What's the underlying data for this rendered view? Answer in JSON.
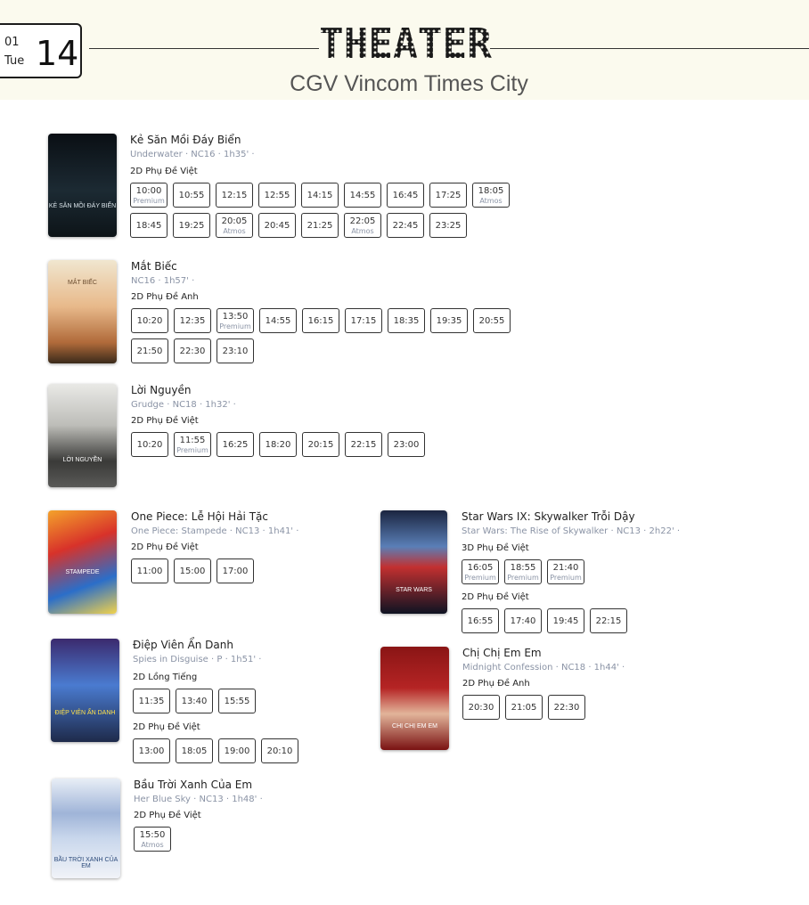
{
  "date": {
    "month": "01",
    "weekday": "Tue",
    "day": "14"
  },
  "header": {
    "title": "THEATER",
    "cinema": "CGV Vincom Times City"
  },
  "movies": [
    {
      "title": "Kẻ Săn Mồi Đáy Biển",
      "meta": "Underwater · NC16 · 1h35' ·",
      "formats": [
        {
          "label": "2D Phụ Đề Việt",
          "showtimes": [
            {
              "time": "10:00",
              "tag": "Premium"
            },
            {
              "time": "10:55"
            },
            {
              "time": "12:15"
            },
            {
              "time": "12:55"
            },
            {
              "time": "14:15"
            },
            {
              "time": "14:55"
            },
            {
              "time": "16:45"
            },
            {
              "time": "17:25"
            },
            {
              "time": "18:05",
              "tag": "Atmos"
            },
            {
              "time": "18:45"
            },
            {
              "time": "19:25"
            },
            {
              "time": "20:05",
              "tag": "Atmos"
            },
            {
              "time": "20:45"
            },
            {
              "time": "21:25"
            },
            {
              "time": "22:05",
              "tag": "Atmos"
            },
            {
              "time": "22:45"
            },
            {
              "time": "23:25"
            }
          ]
        }
      ],
      "poster_text": "KẺ SĂN MỒI ĐÁY BIỂN"
    },
    {
      "title": "Mắt Biếc",
      "meta": "NC16 · 1h57' ·",
      "formats": [
        {
          "label": "2D Phụ Đề Anh",
          "showtimes": [
            {
              "time": "10:20"
            },
            {
              "time": "12:35"
            },
            {
              "time": "13:50",
              "tag": "Premium"
            },
            {
              "time": "14:55"
            },
            {
              "time": "16:15"
            },
            {
              "time": "17:15"
            },
            {
              "time": "18:35"
            },
            {
              "time": "19:35"
            },
            {
              "time": "20:55"
            },
            {
              "time": "21:50"
            },
            {
              "time": "22:30"
            },
            {
              "time": "23:10"
            }
          ]
        }
      ],
      "poster_text": "MẮT BIẾC"
    },
    {
      "title": "Lời Nguyền",
      "meta": "Grudge · NC18 · 1h32' ·",
      "formats": [
        {
          "label": "2D Phụ Đề Việt",
          "showtimes": [
            {
              "time": "10:20"
            },
            {
              "time": "11:55",
              "tag": "Premium"
            },
            {
              "time": "16:25"
            },
            {
              "time": "18:20"
            },
            {
              "time": "20:15"
            },
            {
              "time": "22:15"
            },
            {
              "time": "23:00"
            }
          ]
        }
      ],
      "poster_text": "LỜI NGUYỀN"
    },
    {
      "title": "One Piece: Lễ Hội Hải Tặc",
      "meta": "One Piece: Stampede · NC13 · 1h41' ·",
      "formats": [
        {
          "label": "2D Phụ Đề Việt",
          "showtimes": [
            {
              "time": "11:00"
            },
            {
              "time": "15:00"
            },
            {
              "time": "17:00"
            }
          ]
        }
      ],
      "poster_text": "STAMPEDE"
    },
    {
      "title": "Star Wars IX: Skywalker Trỗi Dậy",
      "meta": "Star Wars: The Rise of Skywalker · NC13 · 2h22' ·",
      "formats": [
        {
          "label": "3D Phụ Đề Việt",
          "showtimes": [
            {
              "time": "16:05",
              "tag": "Premium"
            },
            {
              "time": "18:55",
              "tag": "Premium"
            },
            {
              "time": "21:40",
              "tag": "Premium"
            }
          ]
        },
        {
          "label": "2D Phụ Đề Việt",
          "showtimes": [
            {
              "time": "16:55"
            },
            {
              "time": "17:40"
            },
            {
              "time": "19:45"
            },
            {
              "time": "22:15"
            }
          ]
        }
      ],
      "poster_text": "STAR WARS"
    },
    {
      "title": "Điệp Viên Ẩn Danh",
      "meta": "Spies in Disguise · P · 1h51' ·",
      "formats": [
        {
          "label": "2D Lồng Tiếng",
          "showtimes": [
            {
              "time": "11:35"
            },
            {
              "time": "13:40"
            },
            {
              "time": "15:55"
            }
          ]
        },
        {
          "label": "2D Phụ Đề Việt",
          "showtimes": [
            {
              "time": "13:00"
            },
            {
              "time": "18:05"
            },
            {
              "time": "19:00"
            },
            {
              "time": "20:10"
            }
          ]
        }
      ],
      "poster_text": "ĐIỆP VIÊN ẨN DANH"
    },
    {
      "title": "Chị Chị Em Em",
      "meta": "Midnight Confession · NC18 · 1h44' ·",
      "formats": [
        {
          "label": "2D Phụ Đề Anh",
          "showtimes": [
            {
              "time": "20:30"
            },
            {
              "time": "21:05"
            },
            {
              "time": "22:30"
            }
          ]
        }
      ],
      "poster_text": "CHỊ CHỊ EM EM"
    },
    {
      "title": "Bầu Trời Xanh Của Em",
      "meta": "Her Blue Sky · NC13 · 1h48' ·",
      "formats": [
        {
          "label": "2D Phụ Đề Việt",
          "showtimes": [
            {
              "time": "15:50",
              "tag": "Atmos"
            }
          ]
        }
      ],
      "poster_text": "BẦU TRỜI XANH CỦA EM"
    }
  ]
}
